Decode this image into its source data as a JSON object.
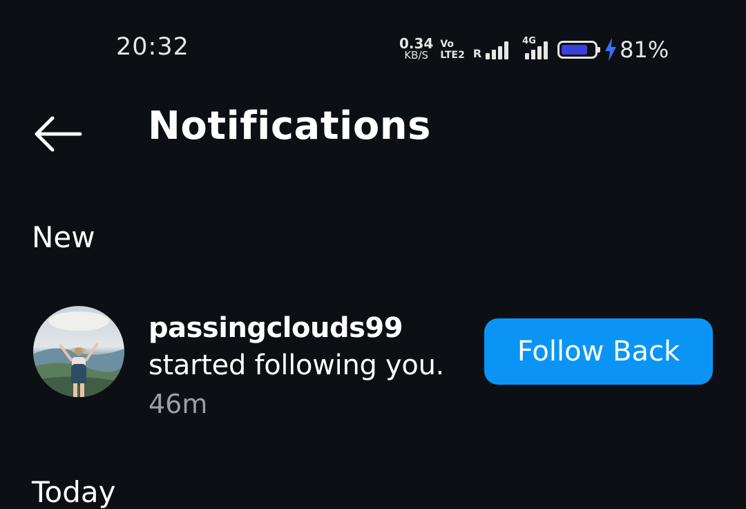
{
  "status_bar": {
    "time": "20:32",
    "net_speed_value": "0.34",
    "net_speed_unit": "KB/S",
    "volte_top": "Vo",
    "volte_bottom": "LTE2",
    "sim1_roaming": "R",
    "sim2_network": "4G",
    "battery_percent": "81%",
    "battery_level": 0.81,
    "battery_color": "#3a3fe0",
    "charging_color": "#3b6df5"
  },
  "header": {
    "back_icon": "arrow-left-icon",
    "title": "Notifications"
  },
  "sections": {
    "new_label": "New",
    "today_label": "Today"
  },
  "notification": {
    "username": "passingclouds99",
    "message": "started following you.",
    "time": "46m",
    "action_label": "Follow Back",
    "action_color": "#0a95f6"
  }
}
